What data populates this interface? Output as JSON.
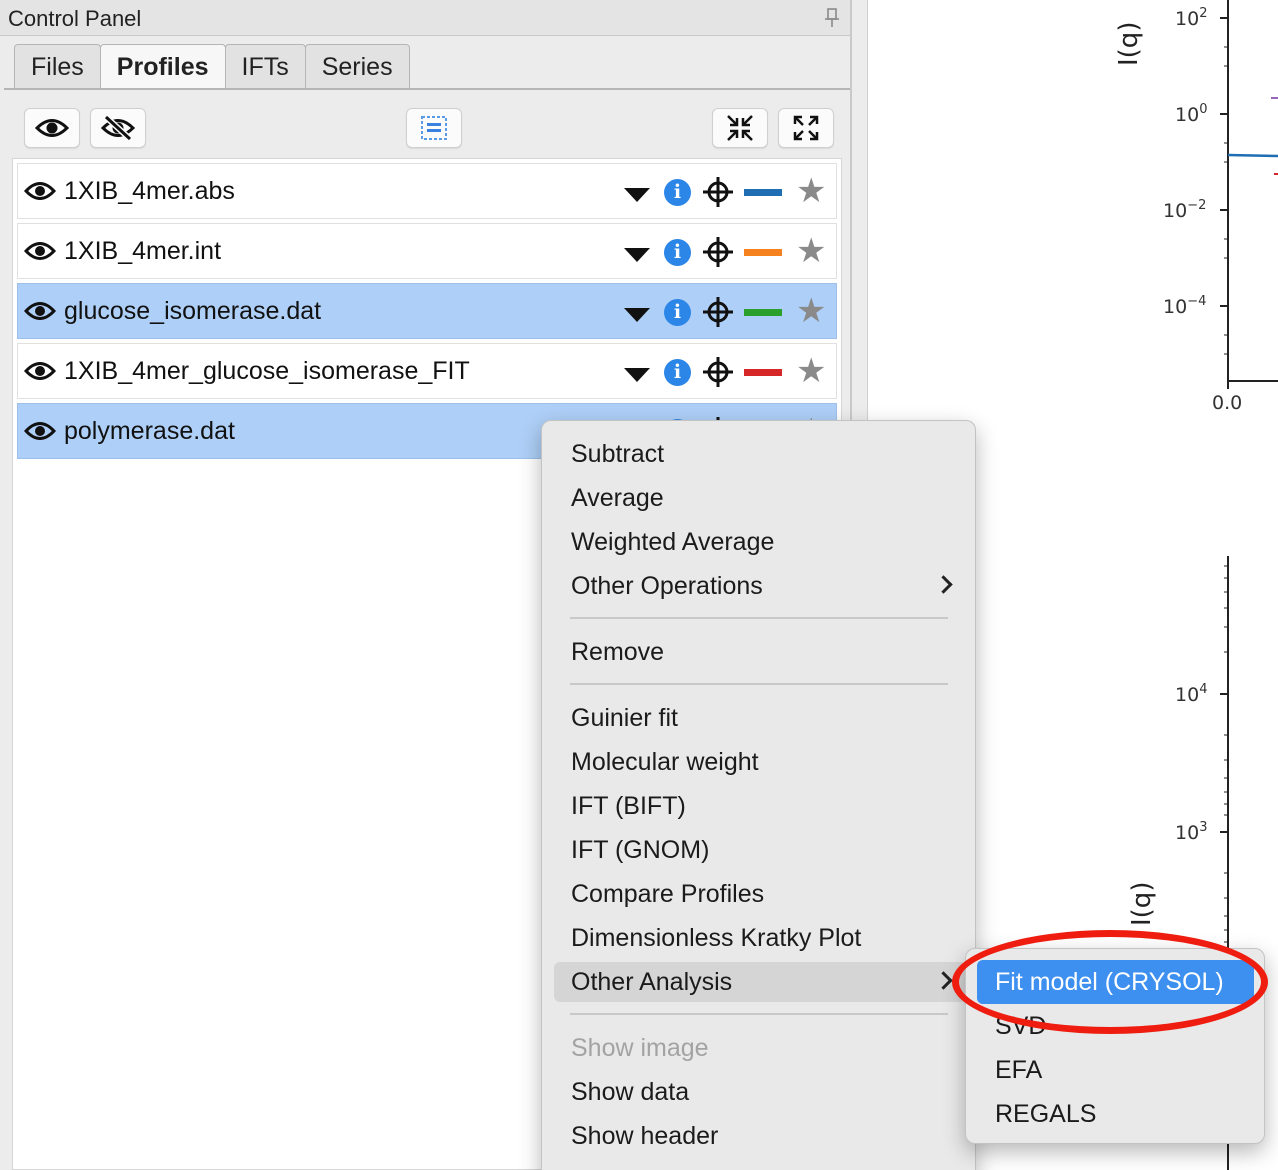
{
  "panel": {
    "title": "Control Panel",
    "tabs": [
      {
        "label": "Files",
        "active": false
      },
      {
        "label": "Profiles",
        "active": true
      },
      {
        "label": "IFTs",
        "active": false
      },
      {
        "label": "Series",
        "active": false
      }
    ],
    "toolbar": {
      "show_all_icon": "eye-icon",
      "hide_all_icon": "eye-slash-icon",
      "select_all_icon": "list-select-icon",
      "collapse_icon": "collapse-arrows-icon",
      "expand_icon": "expand-arrows-icon"
    }
  },
  "profiles": [
    {
      "name": "1XIB_4mer.abs",
      "selected": false,
      "line_color": "#1f6db3"
    },
    {
      "name": "1XIB_4mer.int",
      "selected": false,
      "line_color": "#f5821f"
    },
    {
      "name": "glucose_isomerase.dat",
      "selected": true,
      "line_color": "#2ca02c"
    },
    {
      "name": "1XIB_4mer_glucose_isomerase_FIT",
      "selected": false,
      "line_color": "#d62728"
    },
    {
      "name": "polymerase.dat",
      "selected": true,
      "line_color": "#9467bd"
    }
  ],
  "context_menu": {
    "items": {
      "subtract": "Subtract",
      "average": "Average",
      "weighted_average": "Weighted Average",
      "other_operations": "Other Operations",
      "remove": "Remove",
      "guinier_fit": "Guinier fit",
      "molecular_weight": "Molecular weight",
      "ift_bift": "IFT (BIFT)",
      "ift_gnom": "IFT (GNOM)",
      "compare_profiles": "Compare Profiles",
      "dimensionless_kratky": "Dimensionless Kratky Plot",
      "other_analysis": "Other Analysis",
      "show_image": "Show image",
      "show_data": "Show data",
      "show_header": "Show header"
    },
    "hovered": "Other Analysis",
    "disabled": [
      "Show image"
    ]
  },
  "submenu": {
    "items": [
      "Fit model (CRYSOL)",
      "SVD",
      "EFA",
      "REGALS"
    ],
    "active": "Fit model (CRYSOL)"
  },
  "plot": {
    "top_ylabel": "I(q)",
    "top_ticks": [
      {
        "base": "10",
        "exp": "2"
      },
      {
        "base": "10",
        "exp": "0"
      },
      {
        "base": "10",
        "exp": "−2"
      },
      {
        "base": "10",
        "exp": "−4"
      }
    ],
    "top_xtick": "0.0",
    "bottom_ylabel": "I(q)",
    "bottom_ticks": [
      {
        "base": "10",
        "exp": "4"
      },
      {
        "base": "10",
        "exp": "3"
      }
    ]
  },
  "colors": {
    "selection": "#aecff7",
    "menu_active": "#3d8ff0",
    "annotation": "#ee1d10"
  }
}
